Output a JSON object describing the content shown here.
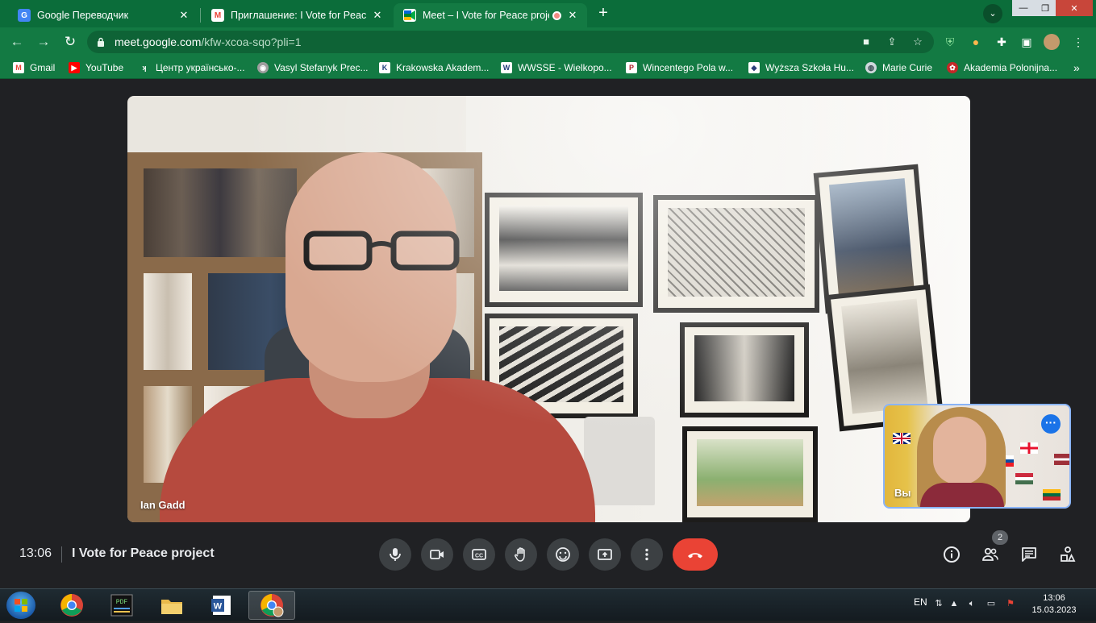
{
  "browser": {
    "tabs": [
      {
        "title": "Google Переводчик",
        "favicon": "google-translate-icon",
        "active": false
      },
      {
        "title": "Приглашение: I Vote for Peace p",
        "favicon": "gmail-icon",
        "active": false
      },
      {
        "title": "Meet – I Vote for Peace proje",
        "favicon": "google-meet-icon",
        "active": true,
        "recording": true
      }
    ],
    "url_host": "meet.google.com",
    "url_path": "/kfw-xcoa-sqo?pli=1",
    "theme_color": "#137a43"
  },
  "bookmarks": [
    {
      "label": "Gmail",
      "icon": "gmail-icon",
      "color": "#ea4335"
    },
    {
      "label": "YouTube",
      "icon": "youtube-icon",
      "color": "#ff0000"
    },
    {
      "label": "Центр українсько-...",
      "icon": "center-icon",
      "color": "#ffffff"
    },
    {
      "label": "Vasyl Stefanyk Prec...",
      "icon": "university-icon",
      "color": "#9e9e9e"
    },
    {
      "label": "Krakowska Akadem...",
      "icon": "akademia-icon",
      "color": "#1a3d7c"
    },
    {
      "label": "WWSSE - Wielkopo...",
      "icon": "wwsse-icon",
      "color": "#243a7a"
    },
    {
      "label": "Wincentego Pola w...",
      "icon": "pola-icon",
      "color": "#b0262c"
    },
    {
      "label": "Wyższa Szkoła Hu...",
      "icon": "wsh-icon",
      "color": "#2c3e7a"
    },
    {
      "label": "Marie Curie",
      "icon": "globe-icon",
      "color": "#cfd8dc"
    },
    {
      "label": "Akademia Polonijna...",
      "icon": "polonijna-icon",
      "color": "#c62828"
    }
  ],
  "meeting": {
    "main_participant": "Ian Gadd",
    "self_label": "Вы",
    "time": "13:06",
    "title": "I Vote for Peace project",
    "participant_count": "2",
    "hangup_color": "#ea4335"
  },
  "taskbar": {
    "language": "EN",
    "clock_time": "13:06",
    "clock_date": "15.03.2023"
  }
}
